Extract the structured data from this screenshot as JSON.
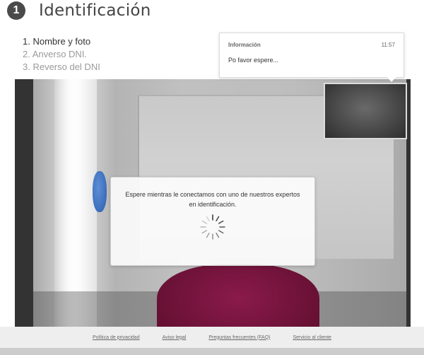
{
  "header": {
    "step_number": "1",
    "title": "Identificación"
  },
  "steps": [
    {
      "label": "1. Nombre y foto",
      "state": "active"
    },
    {
      "label": "2. Anverso DNI.",
      "state": "pending"
    },
    {
      "label": "3. Reverso del DNI",
      "state": "pending"
    }
  ],
  "notification": {
    "title": "Información",
    "time": "11:57",
    "message": "Po favor espere..."
  },
  "modal": {
    "message": "Espere mientras le conectamos con uno de nuestros expertos en identificación.",
    "spinner_icon": "loading-spinner-icon"
  },
  "footer": {
    "links": [
      "Política de privacidad",
      "Aviso legal",
      "Preguntas frecuentes (FAQ)",
      "Servicio al cliente"
    ]
  },
  "colors": {
    "badge": "#4a4a4a",
    "footer_bg": "#eeeeee",
    "shirt": "#7a1340"
  }
}
